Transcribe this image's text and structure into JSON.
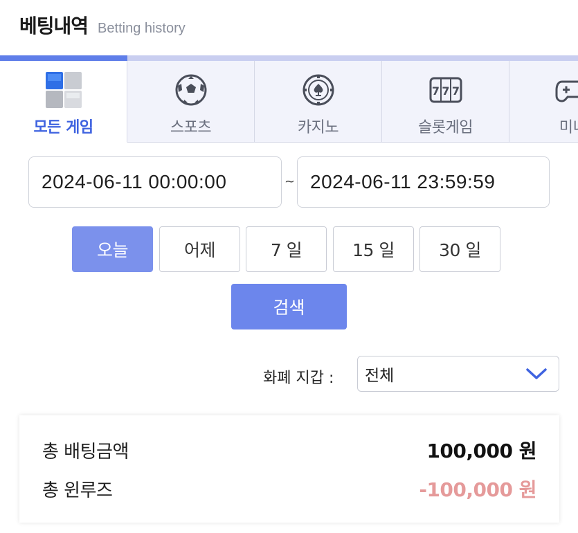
{
  "header": {
    "title": "베팅내역",
    "subtitle": "Betting history"
  },
  "tabs": [
    {
      "label": "모든 게임",
      "icon": "all-games-cubes-icon",
      "active": true
    },
    {
      "label": "스포츠",
      "icon": "soccer-ball-icon",
      "active": false
    },
    {
      "label": "카지노",
      "icon": "casino-chip-spade-icon",
      "active": false
    },
    {
      "label": "슬롯게임",
      "icon": "slot-machine-777-icon",
      "active": false
    },
    {
      "label": "미니",
      "icon": "gamepad-icon",
      "active": false
    }
  ],
  "date_range": {
    "from": "2024-06-11 00:00:00",
    "separator": "~",
    "to": "2024-06-11 23:59:59"
  },
  "quick_ranges": [
    {
      "label": "오늘",
      "active": true
    },
    {
      "label": "어제",
      "active": false
    },
    {
      "label": "7 일",
      "active": false
    },
    {
      "label": "15 일",
      "active": false
    },
    {
      "label": "30 일",
      "active": false
    }
  ],
  "search_label": "검색",
  "currency": {
    "label": "화폐 지갑 :",
    "selected": "전체"
  },
  "summary": {
    "total_bet_label": "총 배팅금액",
    "total_bet_value": "100,000 원",
    "total_winloss_label": "총 윈루즈",
    "total_winloss_value": "-100,000 원"
  },
  "colors": {
    "accent": "#5f7ee9",
    "active_tab_text": "#3f63e0",
    "active_quick_bg": "#7b91ec",
    "search_bg": "#6c86ec",
    "negative": "#e59a9a"
  }
}
